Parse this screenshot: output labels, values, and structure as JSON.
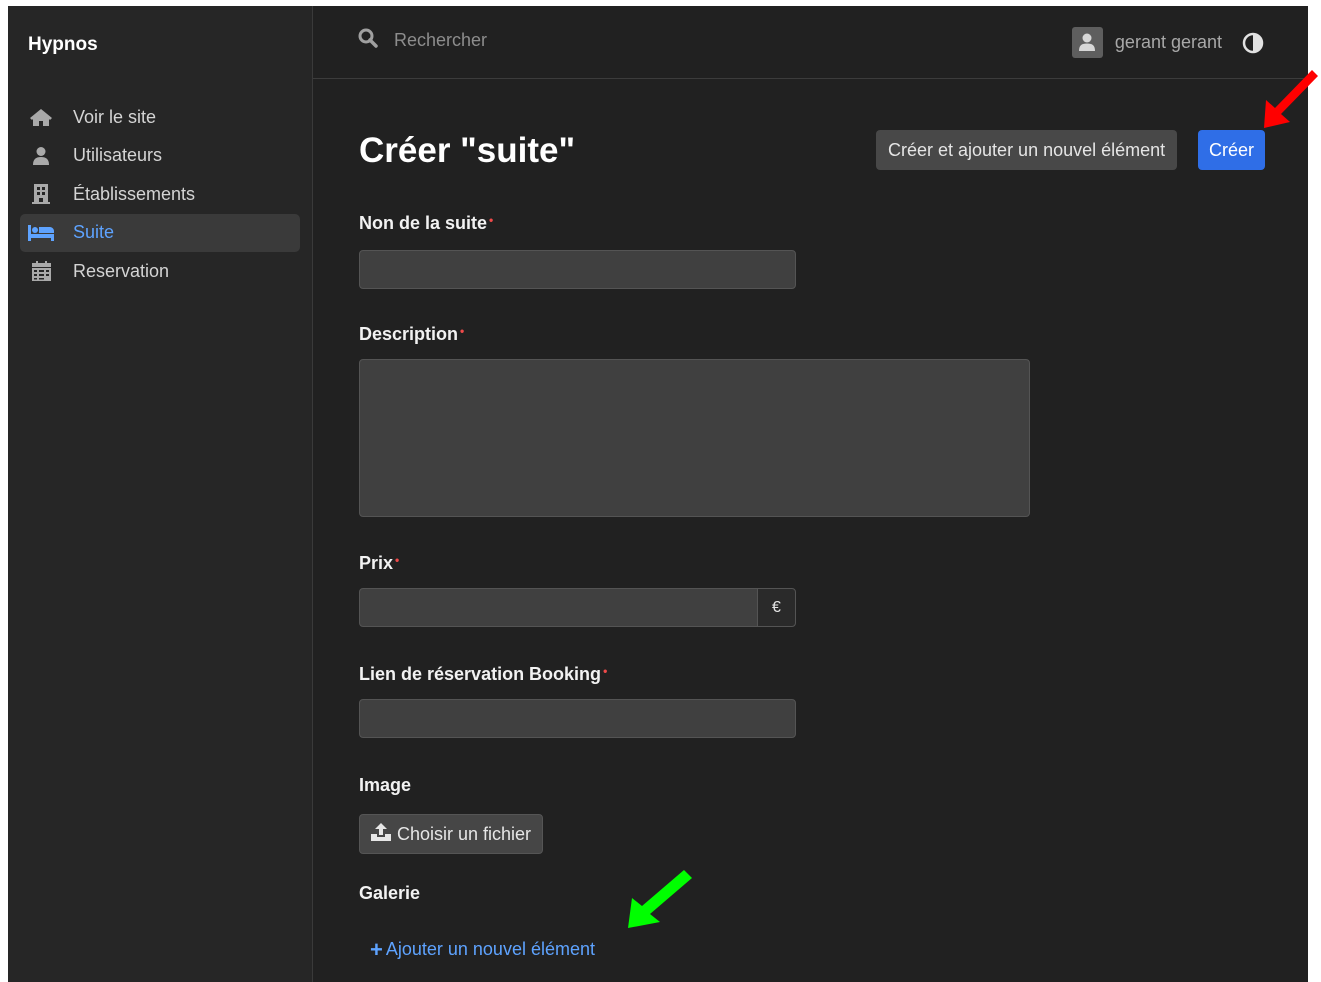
{
  "brand": "Hypnos",
  "sidebar": {
    "items": [
      {
        "label": "Voir le site",
        "icon": "home-icon",
        "active": false
      },
      {
        "label": "Utilisateurs",
        "icon": "user-icon",
        "active": false
      },
      {
        "label": "Établissements",
        "icon": "building-icon",
        "active": false
      },
      {
        "label": "Suite",
        "icon": "bed-icon",
        "active": true
      },
      {
        "label": "Reservation",
        "icon": "calendar-icon",
        "active": false
      }
    ]
  },
  "topbar": {
    "search_placeholder": "Rechercher",
    "username": "gerant gerant"
  },
  "page": {
    "title": "Créer \"suite\"",
    "btn_create_add": "Créer et ajouter un nouvel élément",
    "btn_create": "Créer"
  },
  "form": {
    "name_label": "Non de la suite",
    "description_label": "Description",
    "price_label": "Prix",
    "price_addon": "€",
    "booking_label": "Lien de réservation Booking",
    "image_label": "Image",
    "file_button": "Choisir un fichier",
    "gallery_label": "Galerie",
    "add_item_link": "Ajouter un nouvel élément",
    "required_marker": "•",
    "add_plus": "+"
  },
  "colors": {
    "accent": "#2f6ee7",
    "link": "#5ea3ff",
    "required": "#ef4a4a",
    "annotation_red": "#ff0000",
    "annotation_green": "#00ff00"
  }
}
